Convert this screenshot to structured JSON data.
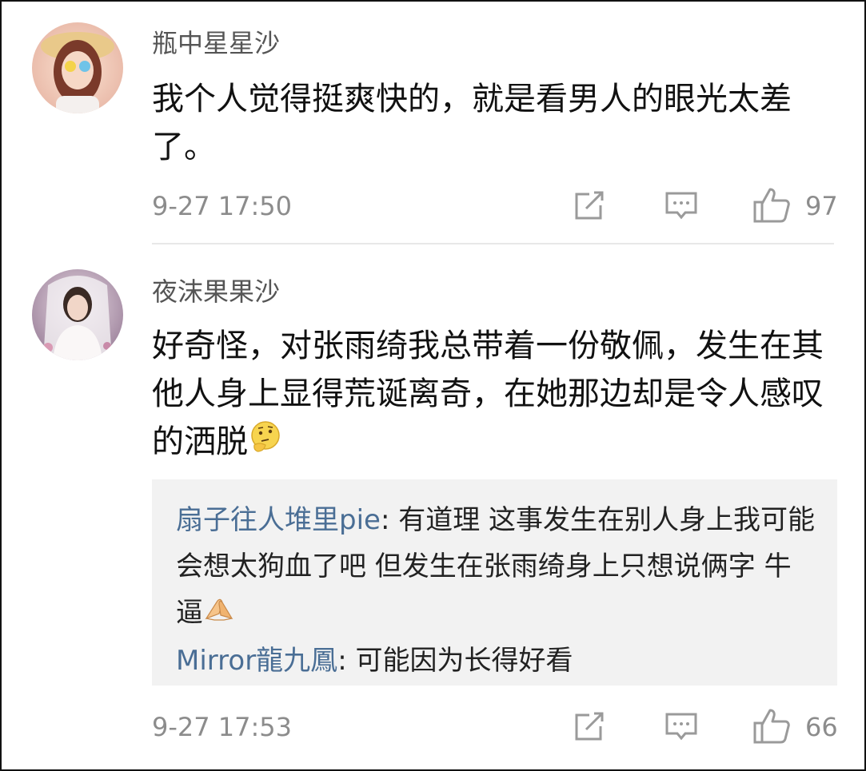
{
  "comments": [
    {
      "username": "瓶中星星沙",
      "text": "我个人觉得挺爽快的，就是看男人的眼光太差了。",
      "time": "9-27 17:50",
      "likes": "97"
    },
    {
      "username": "夜沫果果沙",
      "text": "好奇怪，对张雨绮我总带着一份敬佩，发生在其他人身上显得荒诞离奇，在她那边却是令人感叹的洒脱",
      "time": "9-27 17:53",
      "likes": "66",
      "replies": [
        {
          "name": "扇子往人堆里pie",
          "sep": ": ",
          "text": "有道理 这事发生在别人身上我可能会想太狗血了吧 但发生在张雨绮身上只想说俩字 牛逼"
        },
        {
          "name": "Mirror龍九鳳",
          "sep": ": ",
          "text": "可能因为长得好看"
        }
      ]
    }
  ],
  "icons": {
    "share": "share-icon",
    "comment": "comment-icon",
    "like": "thumbs-up-icon",
    "emoji_thinking": "thinking-face-emoji",
    "emoji_pray": "folded-hands-emoji"
  },
  "colors": {
    "reply_name": "#4a6e95",
    "meta_gray": "#8c8c8c",
    "reply_bg": "#f2f2f2"
  }
}
